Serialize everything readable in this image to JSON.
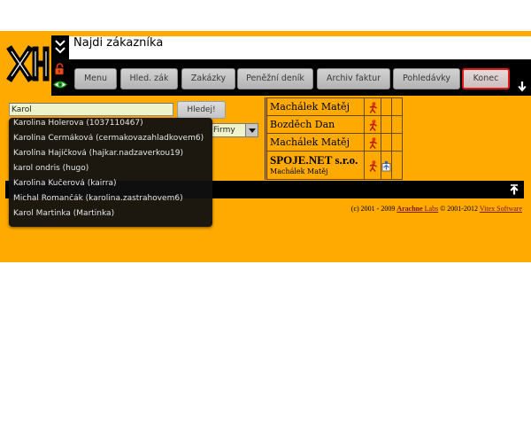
{
  "header": {
    "title": "Najdi zákazníka"
  },
  "toolbar": {
    "buttons": [
      {
        "label": "Menu"
      },
      {
        "label": "Hled. zák"
      },
      {
        "label": "Zakázky"
      },
      {
        "label": "Peněžní deník"
      },
      {
        "label": "Archiv faktur"
      },
      {
        "label": "Pohledávky"
      },
      {
        "label": "Konec"
      }
    ]
  },
  "search": {
    "value": "Karol",
    "submit_label": "Hledej!",
    "type_value": "Firmy"
  },
  "autocomplete": {
    "items": [
      {
        "text": "Karolina Holerova (1037110467)"
      },
      {
        "text": "Karolína Čermáková (cermakovazahladkovem6)"
      },
      {
        "text": "Karolína Hajíčková (hajkar.nadzaverkou19)"
      },
      {
        "text": "karol ondris (hugo)"
      },
      {
        "text": "Karolina Kučerová (kairra)"
      },
      {
        "text": "Michal Romančák (karolina.zastrahovem6)"
      },
      {
        "text": "Karol Martinka (Martinka)"
      }
    ]
  },
  "results": {
    "rows": [
      {
        "name": "Machálek Matěj",
        "icon": "person-icon"
      },
      {
        "name": "Bozděch Dan",
        "icon": "person-icon"
      },
      {
        "name": "Machálek Matěj",
        "icon": "person-icon"
      },
      {
        "name": "SPOJE.NET s.r.o.",
        "contact": "Machálek Matěj",
        "icon": "person-icon",
        "icon2": "contact-card-icon"
      }
    ]
  },
  "footer": {
    "copyright_prefix": "(c) 2001 - 2009",
    "author_link_strong": "Arachne",
    "author_link_rest": "Labs",
    "copyright_middle": "© 2001-2012",
    "vendor_link": "Vitex Software"
  },
  "icons": {
    "logo": "app-logo",
    "collapse": "double-chevron-down-icon",
    "lock": "lock-open-icon",
    "preview": "eye-icon",
    "scroll_down": "arrow-down-icon",
    "scroll_up": "arrow-up-icon",
    "select_arrow": "dropdown-arrow-icon"
  },
  "colors": {
    "page_background": "#ffaa00",
    "bars": "#000000",
    "button": "#c2c2c2",
    "exit_button_border": "#e01818",
    "field_fill": "#eef3cc",
    "autocomplete_background": "#101010",
    "table_border": "#6a4a00",
    "link": "#7a1800"
  }
}
